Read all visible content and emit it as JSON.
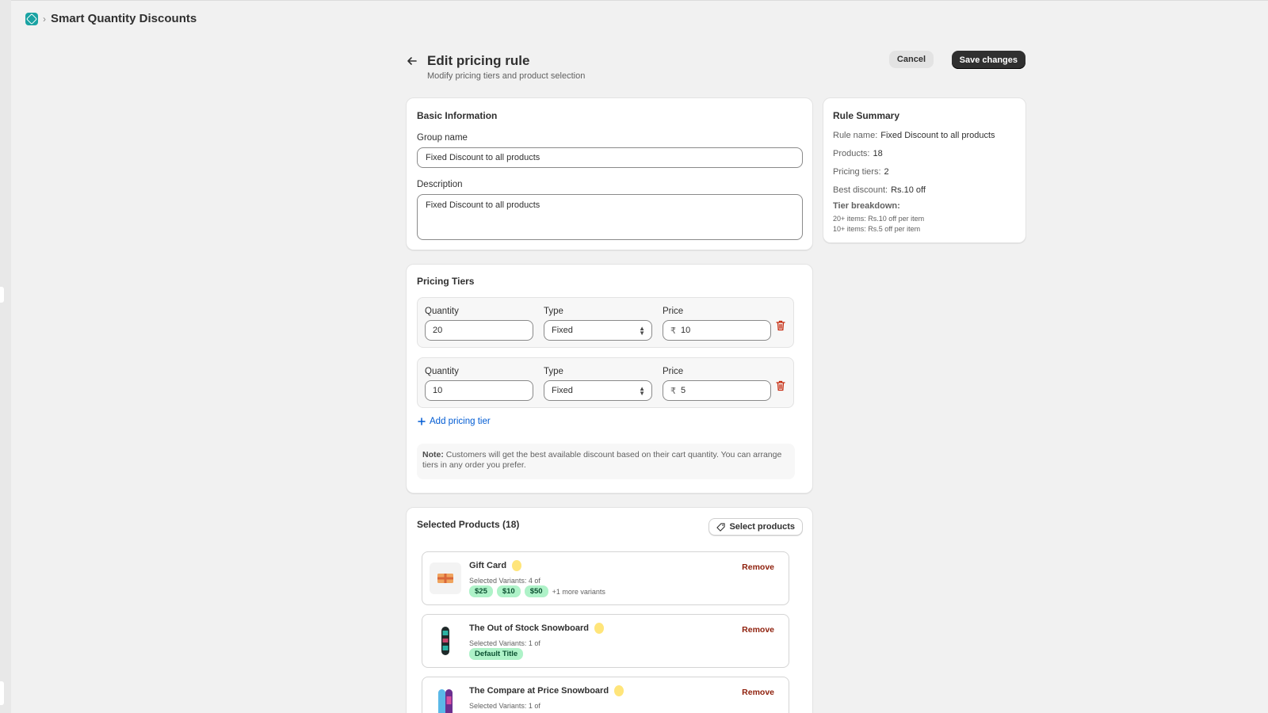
{
  "app": {
    "title": "Smart Quantity Discounts"
  },
  "header": {
    "title": "Edit pricing rule",
    "subtitle": "Modify pricing tiers and product selection",
    "cancel_label": "Cancel",
    "save_label": "Save changes"
  },
  "basic_info": {
    "title": "Basic Information",
    "group_name_label": "Group name",
    "group_name_value": "Fixed Discount to all products",
    "description_label": "Description",
    "description_value": "Fixed Discount to all products"
  },
  "pricing_tiers": {
    "title": "Pricing Tiers",
    "quantity_label": "Quantity",
    "type_label": "Type",
    "price_label": "Price",
    "currency_symbol": "₹",
    "tiers": [
      {
        "quantity": "20",
        "type": "Fixed",
        "price": "10"
      },
      {
        "quantity": "10",
        "type": "Fixed",
        "price": "5"
      }
    ],
    "add_tier_label": "Add pricing tier",
    "note_bold": "Note:",
    "note_text": " Customers will get the best available discount based on their cart quantity. You can arrange tiers in any order you prefer."
  },
  "selected_products": {
    "title": "Selected Products (18)",
    "select_button_label": "Select products",
    "remove_label": "Remove",
    "products": [
      {
        "name": "Gift Card",
        "variants_text": "Selected Variants: 4 of",
        "chips": [
          "$25",
          "$10",
          "$50"
        ],
        "more": "+1 more variants",
        "thumb_icon": "gift-card-icon"
      },
      {
        "name": "The Out of Stock Snowboard",
        "variants_text": "Selected Variants: 1 of",
        "chips": [
          "Default Title"
        ],
        "more": "",
        "thumb_icon": "snowboard-icon"
      },
      {
        "name": "The Compare at Price Snowboard",
        "variants_text": "Selected Variants: 1 of",
        "chips": [],
        "more": "",
        "thumb_icon": "snowboard-icon"
      }
    ]
  },
  "summary": {
    "title": "Rule Summary",
    "rule_name_label": "Rule name:",
    "rule_name_value": "Fixed Discount to all products",
    "products_label": "Products:",
    "products_value": "18",
    "tiers_label": "Pricing tiers:",
    "tiers_value": "2",
    "best_label": "Best discount:",
    "best_value": "Rs.10 off",
    "breakdown_label": "Tier breakdown:",
    "breakdown": [
      "20+ items: Rs.10 off per item",
      "10+ items: Rs.5 off per item"
    ]
  },
  "colors": {
    "primary_button": "#303030",
    "link": "#005bd3",
    "remove": "#8e1f0b",
    "chip_bg": "#aef2c8",
    "status_dot": "#ffe57a",
    "app_logo": "#1aa3a3"
  }
}
